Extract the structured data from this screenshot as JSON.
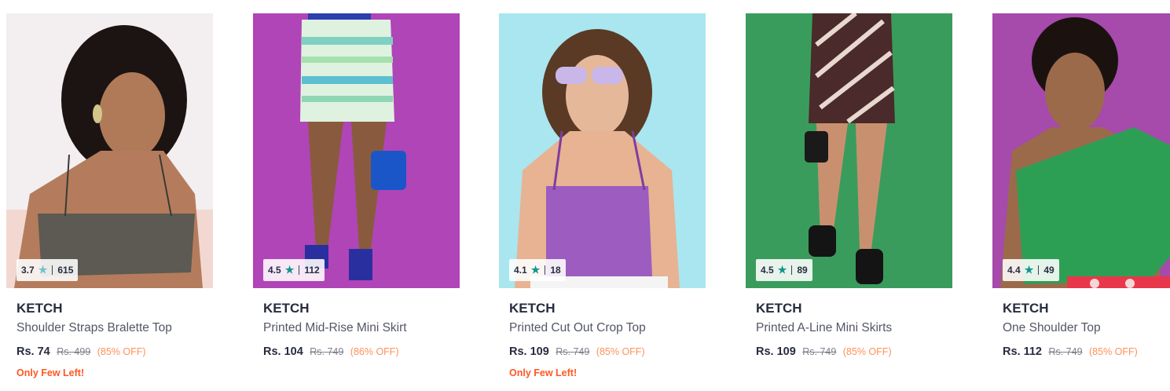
{
  "colors": {
    "rating_star": "#14958f",
    "discount": "#ff905a",
    "few_left": "#ff5722",
    "brand_text": "#282c3f"
  },
  "products": [
    {
      "brand": "KETCH",
      "name": "Shoulder Straps Bralette Top",
      "price": "Rs. 74",
      "mrp": "Rs. 499",
      "discount": "(85% OFF)",
      "rating": "3.7",
      "rating_count": "615",
      "stock_note": "Only Few Left!",
      "bg_color": "#f3eef0",
      "star_color": "#72c3c6"
    },
    {
      "brand": "KETCH",
      "name": "Printed Mid-Rise Mini Skirt",
      "price": "Rs. 104",
      "mrp": "Rs. 749",
      "discount": "(86% OFF)",
      "rating": "4.5",
      "rating_count": "112",
      "stock_note": "",
      "bg_color": "#b045b7",
      "star_color": "#14958f"
    },
    {
      "brand": "KETCH",
      "name": "Printed Cut Out Crop Top",
      "price": "Rs. 109",
      "mrp": "Rs. 749",
      "discount": "(85% OFF)",
      "rating": "4.1",
      "rating_count": "18",
      "stock_note": "Only Few Left!",
      "bg_color": "#a9e6ef",
      "star_color": "#14958f"
    },
    {
      "brand": "KETCH",
      "name": "Printed A-Line Mini Skirts",
      "price": "Rs. 109",
      "mrp": "Rs. 749",
      "discount": "(85% OFF)",
      "rating": "4.5",
      "rating_count": "89",
      "stock_note": "",
      "bg_color": "#3a9c5c",
      "star_color": "#14958f"
    },
    {
      "brand": "KETCH",
      "name": "One Shoulder Top",
      "price": "Rs. 112",
      "mrp": "Rs. 749",
      "discount": "(85% OFF)",
      "rating": "4.4",
      "rating_count": "49",
      "stock_note": "",
      "bg_color": "#a64aac",
      "star_color": "#14958f"
    }
  ]
}
